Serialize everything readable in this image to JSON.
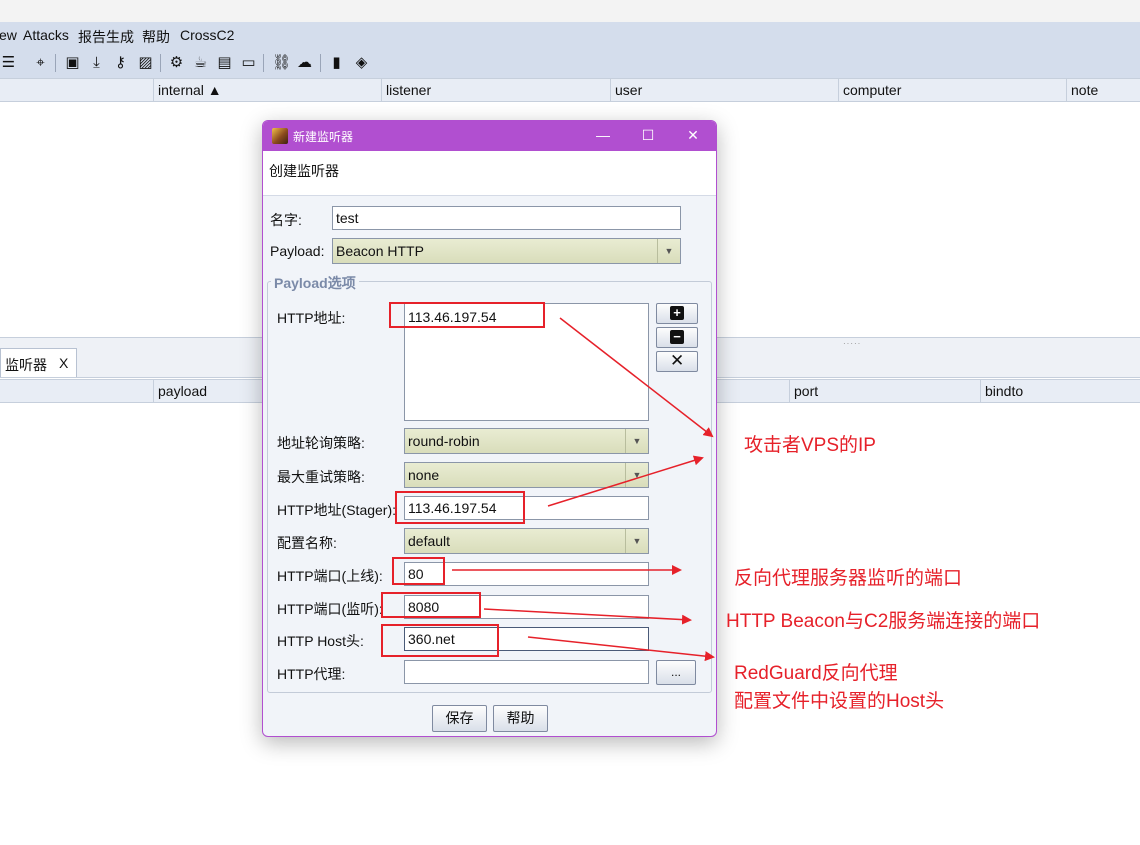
{
  "menu": [
    "ew",
    "Attacks",
    "报告生成",
    "帮助",
    "CrossC2"
  ],
  "toolbar_icons": [
    "list-icon",
    "crosshair-icon",
    "id-card-icon",
    "download-icon",
    "key-icon",
    "image-icon",
    "gear-icon",
    "coffee-icon",
    "document-icon",
    "terminal-icon",
    "link-icon",
    "cloud-icon",
    "book-icon",
    "cube-icon"
  ],
  "top_table": {
    "columns": [
      "internal ▲",
      "listener",
      "user",
      "computer",
      "note"
    ]
  },
  "bottom_panel": {
    "tab_label": "监听器",
    "tab_close": "X",
    "columns": [
      "payload",
      "port",
      "bindto"
    ]
  },
  "dialog": {
    "title": "新建监听器",
    "minimize": "—",
    "maximize": "☐",
    "close": "✕",
    "banner": "创建监听器",
    "name_label": "名字:",
    "name_value": "test",
    "payload_label": "Payload:",
    "payload_value": "Beacon HTTP",
    "group_title": "Payload选项",
    "http_hosts_label": "HTTP地址:",
    "http_hosts_value": "113.46.197.54",
    "rotate_label": "地址轮询策略:",
    "rotate_value": "round-robin",
    "retry_label": "最大重试策略:",
    "retry_value": "none",
    "stager_label": "HTTP地址(Stager):",
    "stager_value": "113.46.197.54",
    "profile_label": "配置名称:",
    "profile_value": "default",
    "port_c2_label": "HTTP端口(上线):",
    "port_c2_value": "80",
    "port_bind_label": "HTTP端口(监听):",
    "port_bind_value": "8080",
    "host_header_label": "HTTP Host头:",
    "host_header_value": "360.net",
    "proxy_label": "HTTP代理:",
    "proxy_value": "",
    "proxy_button": "...",
    "add_button": "+",
    "remove_button": "−",
    "clear_button": "✕",
    "save_button": "保存",
    "help_button": "帮助"
  },
  "annotations": {
    "vps_ip": "攻击者VPS的IP",
    "reverse_port": "反向代理服务器监听的端口",
    "c2_port": "HTTP Beacon与C2服务端连接的端口",
    "host_line1": "RedGuard反向代理",
    "host_line2": "配置文件中设置的Host头",
    "color": "#e6212a"
  }
}
